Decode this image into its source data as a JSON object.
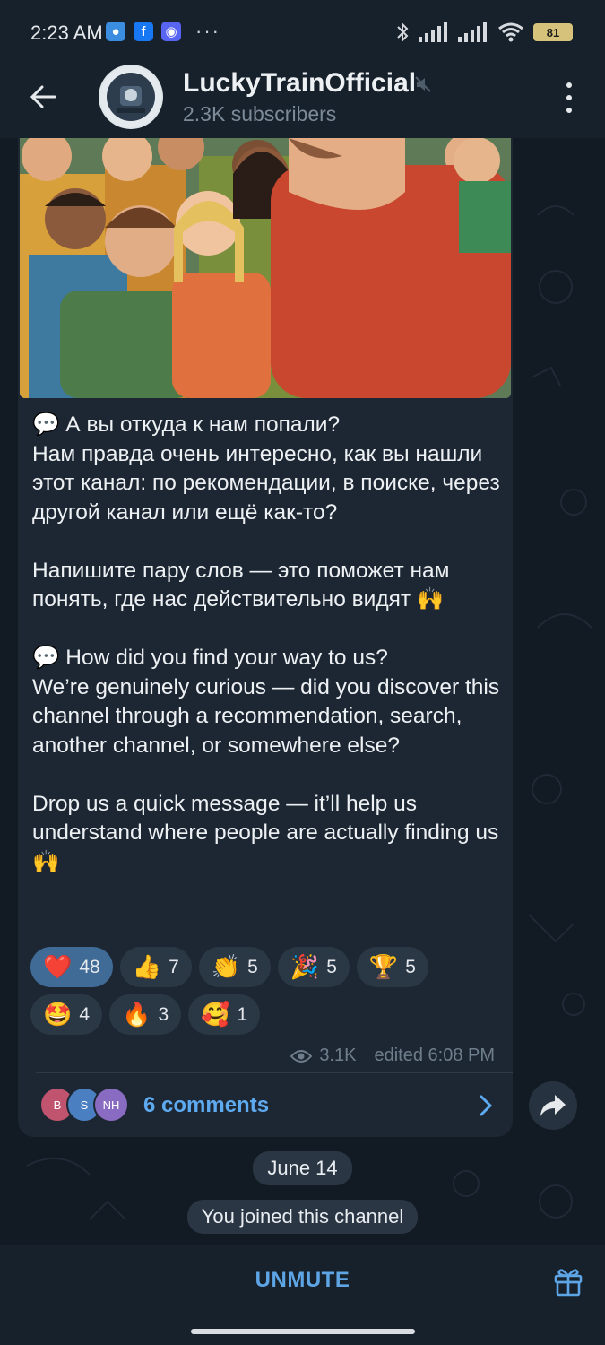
{
  "status_bar": {
    "time": "2:23 AM",
    "battery": "81",
    "dots": "···"
  },
  "header": {
    "channel_name": "LuckyTrainOfficial",
    "subscribers": "2.3K subscribers"
  },
  "post": {
    "text": "💬 А вы откуда к нам попали?\nНам правда очень интересно, как вы нашли этот канал: по рекомендации, в поиске, через другой канал или ещё как-то?\n\nНапишите пару слов — это поможет нам понять, где нас действительно видят 🙌\n\n💬 How did you find your way to us?\nWe’re genuinely curious — did you discover this channel through a recommendation, search, another channel, or somewhere else?\n\nDrop us a quick message — it’ll help us understand where people are actually finding us 🙌",
    "reactions": [
      {
        "emoji": "❤️",
        "count": "48"
      },
      {
        "emoji": "👍",
        "count": "7"
      },
      {
        "emoji": "👏",
        "count": "5"
      },
      {
        "emoji": "🎉",
        "count": "5"
      },
      {
        "emoji": "🏆",
        "count": "5"
      },
      {
        "emoji": "🤩",
        "count": "4"
      },
      {
        "emoji": "🔥",
        "count": "3"
      },
      {
        "emoji": "🥰",
        "count": "1"
      }
    ],
    "views": "3.1K",
    "edited": "edited 6:08 PM",
    "comments_label": "6 comments",
    "commenter_avatars": [
      {
        "initials": "B",
        "color": "#c0546e"
      },
      {
        "initials": "S",
        "color": "#4a80c2"
      },
      {
        "initials": "NH",
        "color": "#8a6bc2"
      }
    ]
  },
  "service": {
    "date": "June 14",
    "joined": "You joined this channel"
  },
  "bottom": {
    "unmute": "UNMUTE"
  },
  "colors": {
    "accent": "#5ea5e6",
    "bubble": "#1d2733",
    "header": "#17212b"
  }
}
